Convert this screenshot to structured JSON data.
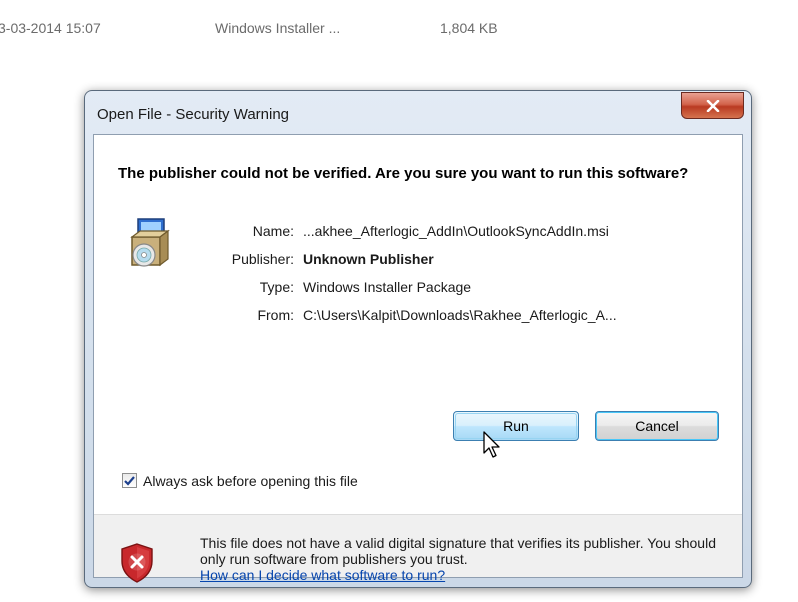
{
  "background_row": {
    "date": "3-03-2014 15:07",
    "type": "Windows Installer ...",
    "size": "1,804 KB"
  },
  "dialog": {
    "title": "Open File - Security Warning",
    "headline": "The publisher could not be verified.  Are you sure you want to run this software?",
    "fields": [
      {
        "label": "Name:",
        "value": "...akhee_Afterlogic_AddIn\\OutlookSyncAddIn.msi",
        "bold": false
      },
      {
        "label": "Publisher:",
        "value": "Unknown Publisher",
        "bold": true
      },
      {
        "label": "Type:",
        "value": "Windows Installer Package",
        "bold": false
      },
      {
        "label": "From:",
        "value": "C:\\Users\\Kalpit\\Downloads\\Rakhee_Afterlogic_A...",
        "bold": false
      }
    ],
    "run_label": "Run",
    "cancel_label": "Cancel",
    "checkbox_label": "Always ask before opening this file",
    "checkbox_checked": true,
    "footer_text": "This file does not have a valid digital signature that verifies its publisher.  You should only run software from publishers you trust.",
    "footer_link": "How can I decide what software to run?"
  },
  "icons": {
    "close": "close-icon",
    "installer": "installer-package-icon",
    "shield": "security-shield-icon",
    "cursor": "mouse-cursor-icon",
    "check": "checkmark-icon"
  },
  "colors": {
    "close_red": "#c9452a",
    "link_blue": "#0645ad",
    "shield_red": "#c8282c"
  }
}
